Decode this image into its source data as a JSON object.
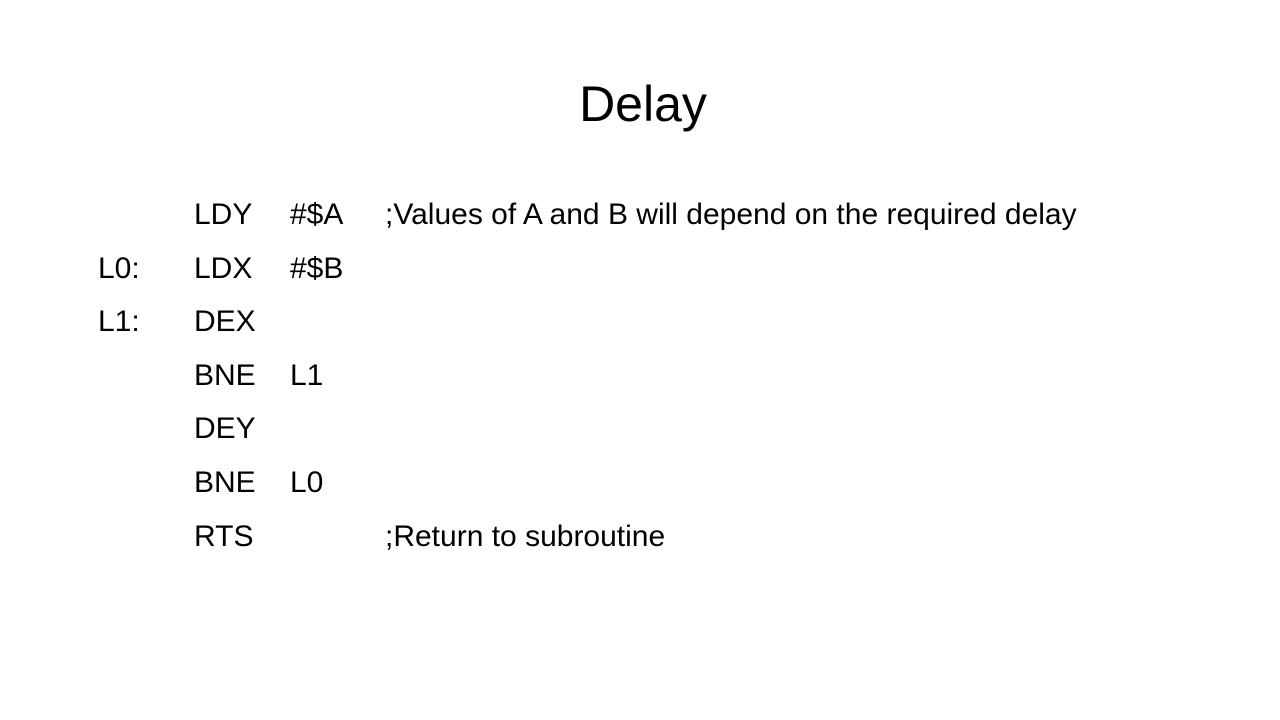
{
  "slide": {
    "title": "Delay",
    "lines": [
      {
        "label": "",
        "opcode": "LDY",
        "operand": "#$A",
        "comment": ";Values of A and B will depend on the required delay"
      },
      {
        "label": "L0:",
        "opcode": "LDX",
        "operand": "#$B",
        "comment": ""
      },
      {
        "label": "L1:",
        "opcode": "DEX",
        "operand": "",
        "comment": ""
      },
      {
        "label": "",
        "opcode": "BNE",
        "operand": "L1",
        "comment": ""
      },
      {
        "label": "",
        "opcode": "DEY",
        "operand": "",
        "comment": ""
      },
      {
        "label": "",
        "opcode": "BNE",
        "operand": "L0",
        "comment": ""
      },
      {
        "label": "",
        "opcode": "RTS",
        "operand": "",
        "comment": ";Return to subroutine"
      }
    ]
  }
}
